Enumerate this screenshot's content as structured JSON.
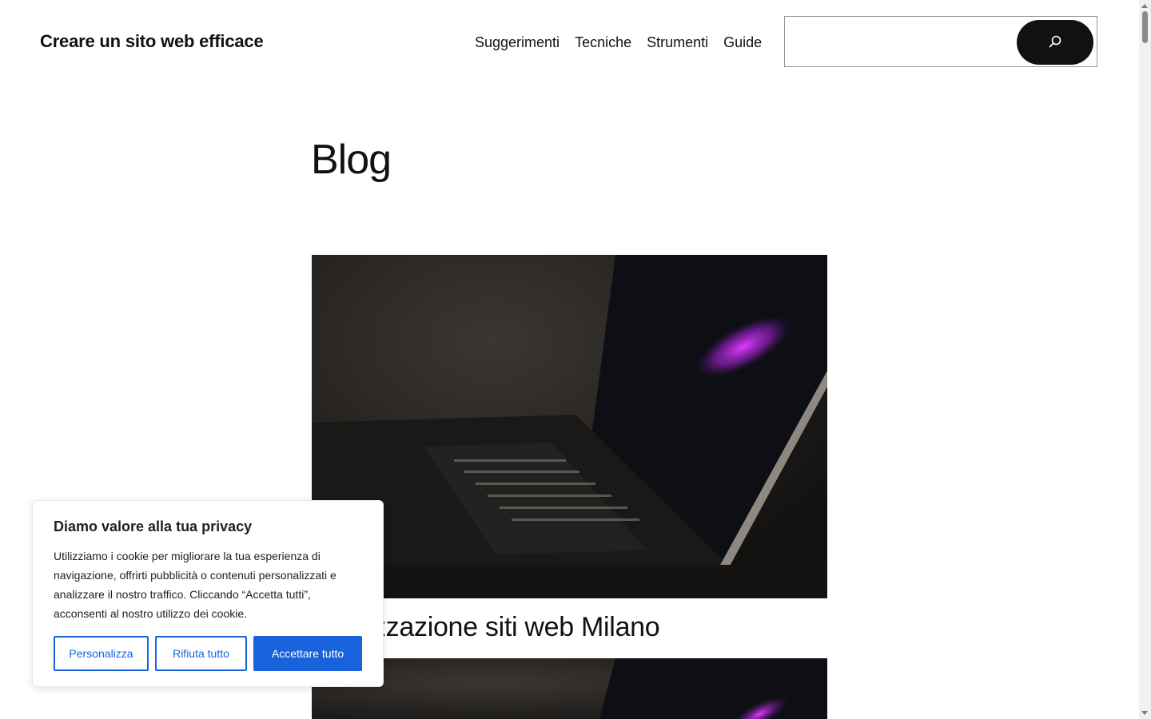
{
  "header": {
    "site_title": "Creare un sito web efficace",
    "nav": [
      "Suggerimenti",
      "Tecniche",
      "Strumenti",
      "Guide"
    ],
    "search": {
      "value": "",
      "icon": "search-icon"
    }
  },
  "main": {
    "page_title": "Blog",
    "posts": [
      {
        "title": "Realizzazione siti web Milano",
        "image": "laptop-dark-photo"
      },
      {
        "title": "",
        "image": "laptop-dark-photo"
      }
    ]
  },
  "cookie_banner": {
    "title": "Diamo valore alla tua privacy",
    "text": "Utilizziamo i cookie per migliorare la tua esperienza di navigazione, offrirti pubblicità o contenuti personalizzati e analizzare il nostro traffico. Cliccando “Accetta tutti”, acconsenti al nostro utilizzo dei cookie.",
    "buttons": {
      "customize": "Personalizza",
      "reject": "Rifiuta tutto",
      "accept": "Accettare tutto"
    },
    "accent_color": "#1863dc"
  }
}
